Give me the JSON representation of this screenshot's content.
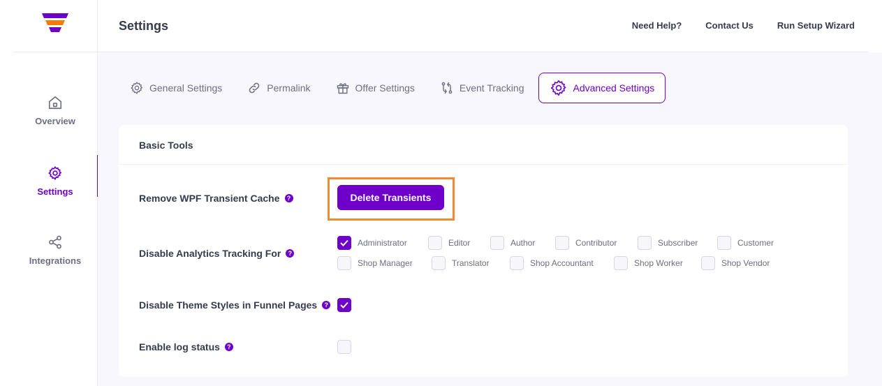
{
  "sidebar": {
    "items": [
      {
        "label": "Overview",
        "icon": "home-icon"
      },
      {
        "label": "Settings",
        "icon": "gear-icon",
        "active": true
      },
      {
        "label": "Integrations",
        "icon": "share-icon"
      }
    ]
  },
  "header": {
    "title": "Settings",
    "links": [
      "Need Help?",
      "Contact Us",
      "Run Setup Wizard"
    ]
  },
  "tabs": [
    {
      "label": "General Settings",
      "icon": "gear-icon"
    },
    {
      "label": "Permalink",
      "icon": "link-icon"
    },
    {
      "label": "Offer Settings",
      "icon": "gift-icon"
    },
    {
      "label": "Event Tracking",
      "icon": "tracking-icon"
    },
    {
      "label": "Advanced Settings",
      "icon": "gear-icon",
      "active": true
    }
  ],
  "card": {
    "title": "Basic Tools",
    "transient": {
      "label": "Remove WPF Transient Cache",
      "button": "Delete Transients"
    },
    "analytics": {
      "label": "Disable Analytics Tracking For",
      "roles": [
        {
          "name": "Administrator",
          "checked": true
        },
        {
          "name": "Editor",
          "checked": false
        },
        {
          "name": "Author",
          "checked": false
        },
        {
          "name": "Contributor",
          "checked": false
        },
        {
          "name": "Subscriber",
          "checked": false
        },
        {
          "name": "Customer",
          "checked": false
        },
        {
          "name": "Shop Manager",
          "checked": false
        },
        {
          "name": "Translator",
          "checked": false
        },
        {
          "name": "Shop Accountant",
          "checked": false
        },
        {
          "name": "Shop Worker",
          "checked": false
        },
        {
          "name": "Shop Vendor",
          "checked": false
        }
      ]
    },
    "theme_styles": {
      "label": "Disable Theme Styles in Funnel Pages",
      "checked": true
    },
    "log_status": {
      "label": "Enable log status",
      "checked": false
    }
  },
  "help_glyph": "?",
  "colors": {
    "accent": "#6e00c9",
    "highlight": "#f08a35",
    "logo_top": "#6e00c9",
    "logo_mid": "#f57c00"
  }
}
